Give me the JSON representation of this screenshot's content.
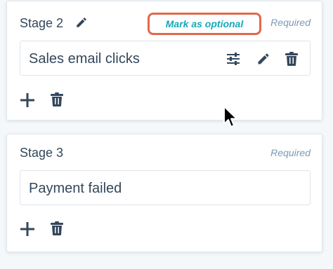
{
  "stages": [
    {
      "title": "Stage 2",
      "mark_optional_label": "Mark as optional",
      "required_label": "Required",
      "field_value": "Sales email clicks"
    },
    {
      "title": "Stage 3",
      "required_label": "Required",
      "field_value": "Payment failed"
    }
  ],
  "icons": {
    "edit_title": "pencil-icon",
    "filters": "sliders-icon",
    "edit": "pencil-icon",
    "delete": "trash-icon",
    "add": "plus-icon",
    "cursor": "mouse-pointer-icon"
  },
  "colors": {
    "text": "#33475b",
    "teal_link": "#13a9b7",
    "highlight_border": "#e0694c",
    "required_text": "#7c98b6"
  }
}
